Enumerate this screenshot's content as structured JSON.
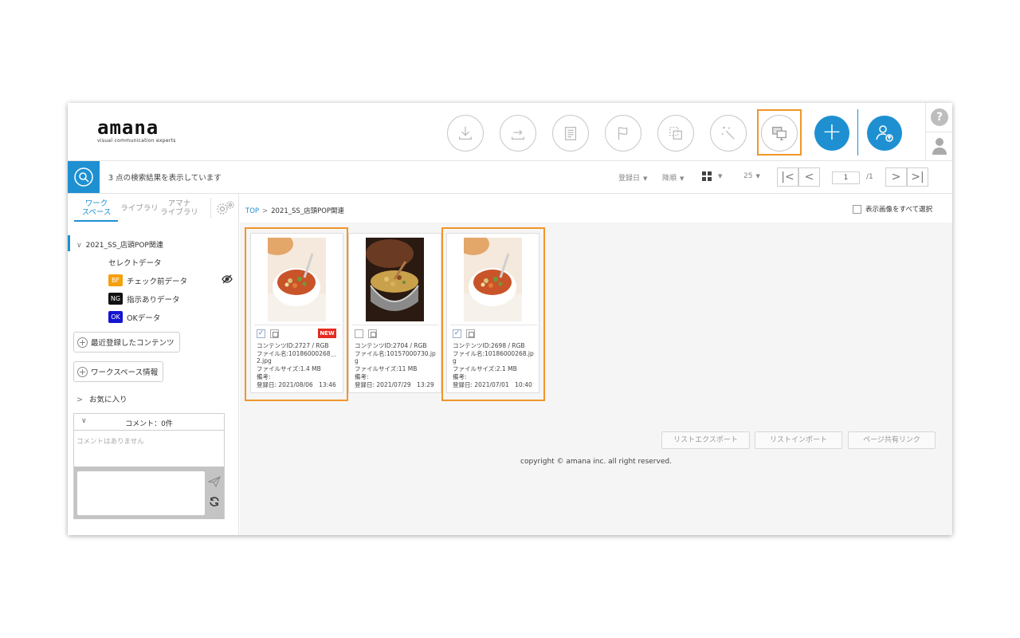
{
  "logo": {
    "main": "amana",
    "sub": "visual communication experts"
  },
  "header": {
    "help_label": "?",
    "plus_label": "+",
    "tools": [
      {
        "icon": "download-icon"
      },
      {
        "icon": "export-icon"
      },
      {
        "icon": "document-icon"
      },
      {
        "icon": "flag-icon"
      },
      {
        "icon": "crop-icon"
      },
      {
        "icon": "magic-wand-icon"
      },
      {
        "icon": "monitor-icon",
        "highlighted": true
      }
    ]
  },
  "search": {
    "result_text": "3 点の検索結果を表示しています",
    "sort_field": "登録日",
    "sort_order": "降順",
    "per_page": "25",
    "page_current": "1",
    "page_total": "/1"
  },
  "sidebar": {
    "tabs": [
      "ワーク\nスペース",
      "ライブラリ",
      "アマナ\nライブラリ"
    ],
    "tab_lines": [
      [
        "ワーク",
        "スペース"
      ],
      [
        "ライブラリ"
      ],
      [
        "アマナ",
        "ライブラリ"
      ]
    ],
    "tree_root": "2021_SS_店頭POP関連",
    "items": [
      {
        "label": "セレクトデータ"
      },
      {
        "label": "チェック前データ",
        "badge": "BF",
        "badge_color": "#f5a00f"
      },
      {
        "label": "指示ありデータ",
        "badge": "NG",
        "badge_color": "#111111"
      },
      {
        "label": "OKデータ",
        "badge": "OK",
        "badge_color": "#1414d2"
      }
    ],
    "recent_button": "最近登録したコンテンツ",
    "workspace_info_button": "ワークスペース情報",
    "favorites": "お気に入り",
    "comment_title": "コメント：0件",
    "comment_empty": "コメントはありません"
  },
  "main": {
    "breadcrumb_top": "TOP",
    "breadcrumb_sep": ">",
    "breadcrumb_current": "2021_SS_店頭POP関連",
    "select_all": "表示画像をすべて選択",
    "cards": [
      {
        "content_id": "コンテンツID:2727 / RGB",
        "file_name": "ファイル名:10186000268＿2.jpg",
        "file_size": "ファイルサイズ:1.4 MB",
        "note": "備考:",
        "registered": "登録日: 2021/08/06　13:46",
        "checked": true,
        "is_new": true,
        "new_label": "NEW",
        "highlighted": true
      },
      {
        "content_id": "コンテンツID:2704 / RGB",
        "file_name": "ファイル名:10157000730.jpg",
        "file_size": "ファイルサイズ:11 MB",
        "note": "備考:",
        "registered": "登録日: 2021/07/29　13:29",
        "checked": false,
        "is_new": false,
        "highlighted": false
      },
      {
        "content_id": "コンテンツID:2698 / RGB",
        "file_name": "ファイル名:10186000268.jpg",
        "file_size": "ファイルサイズ:2.1 MB",
        "note": "備考:",
        "registered": "登録日: 2021/07/01　10:40",
        "checked": true,
        "is_new": false,
        "highlighted": true
      }
    ],
    "footer_buttons": [
      "リストエクスポート",
      "リストインポート",
      "ページ共有リンク"
    ],
    "copyright": "copyright © amana inc. all right reserved."
  },
  "colors": {
    "accent": "#1e90d2",
    "highlight": "#f0962a",
    "new_badge": "#e52b20"
  }
}
